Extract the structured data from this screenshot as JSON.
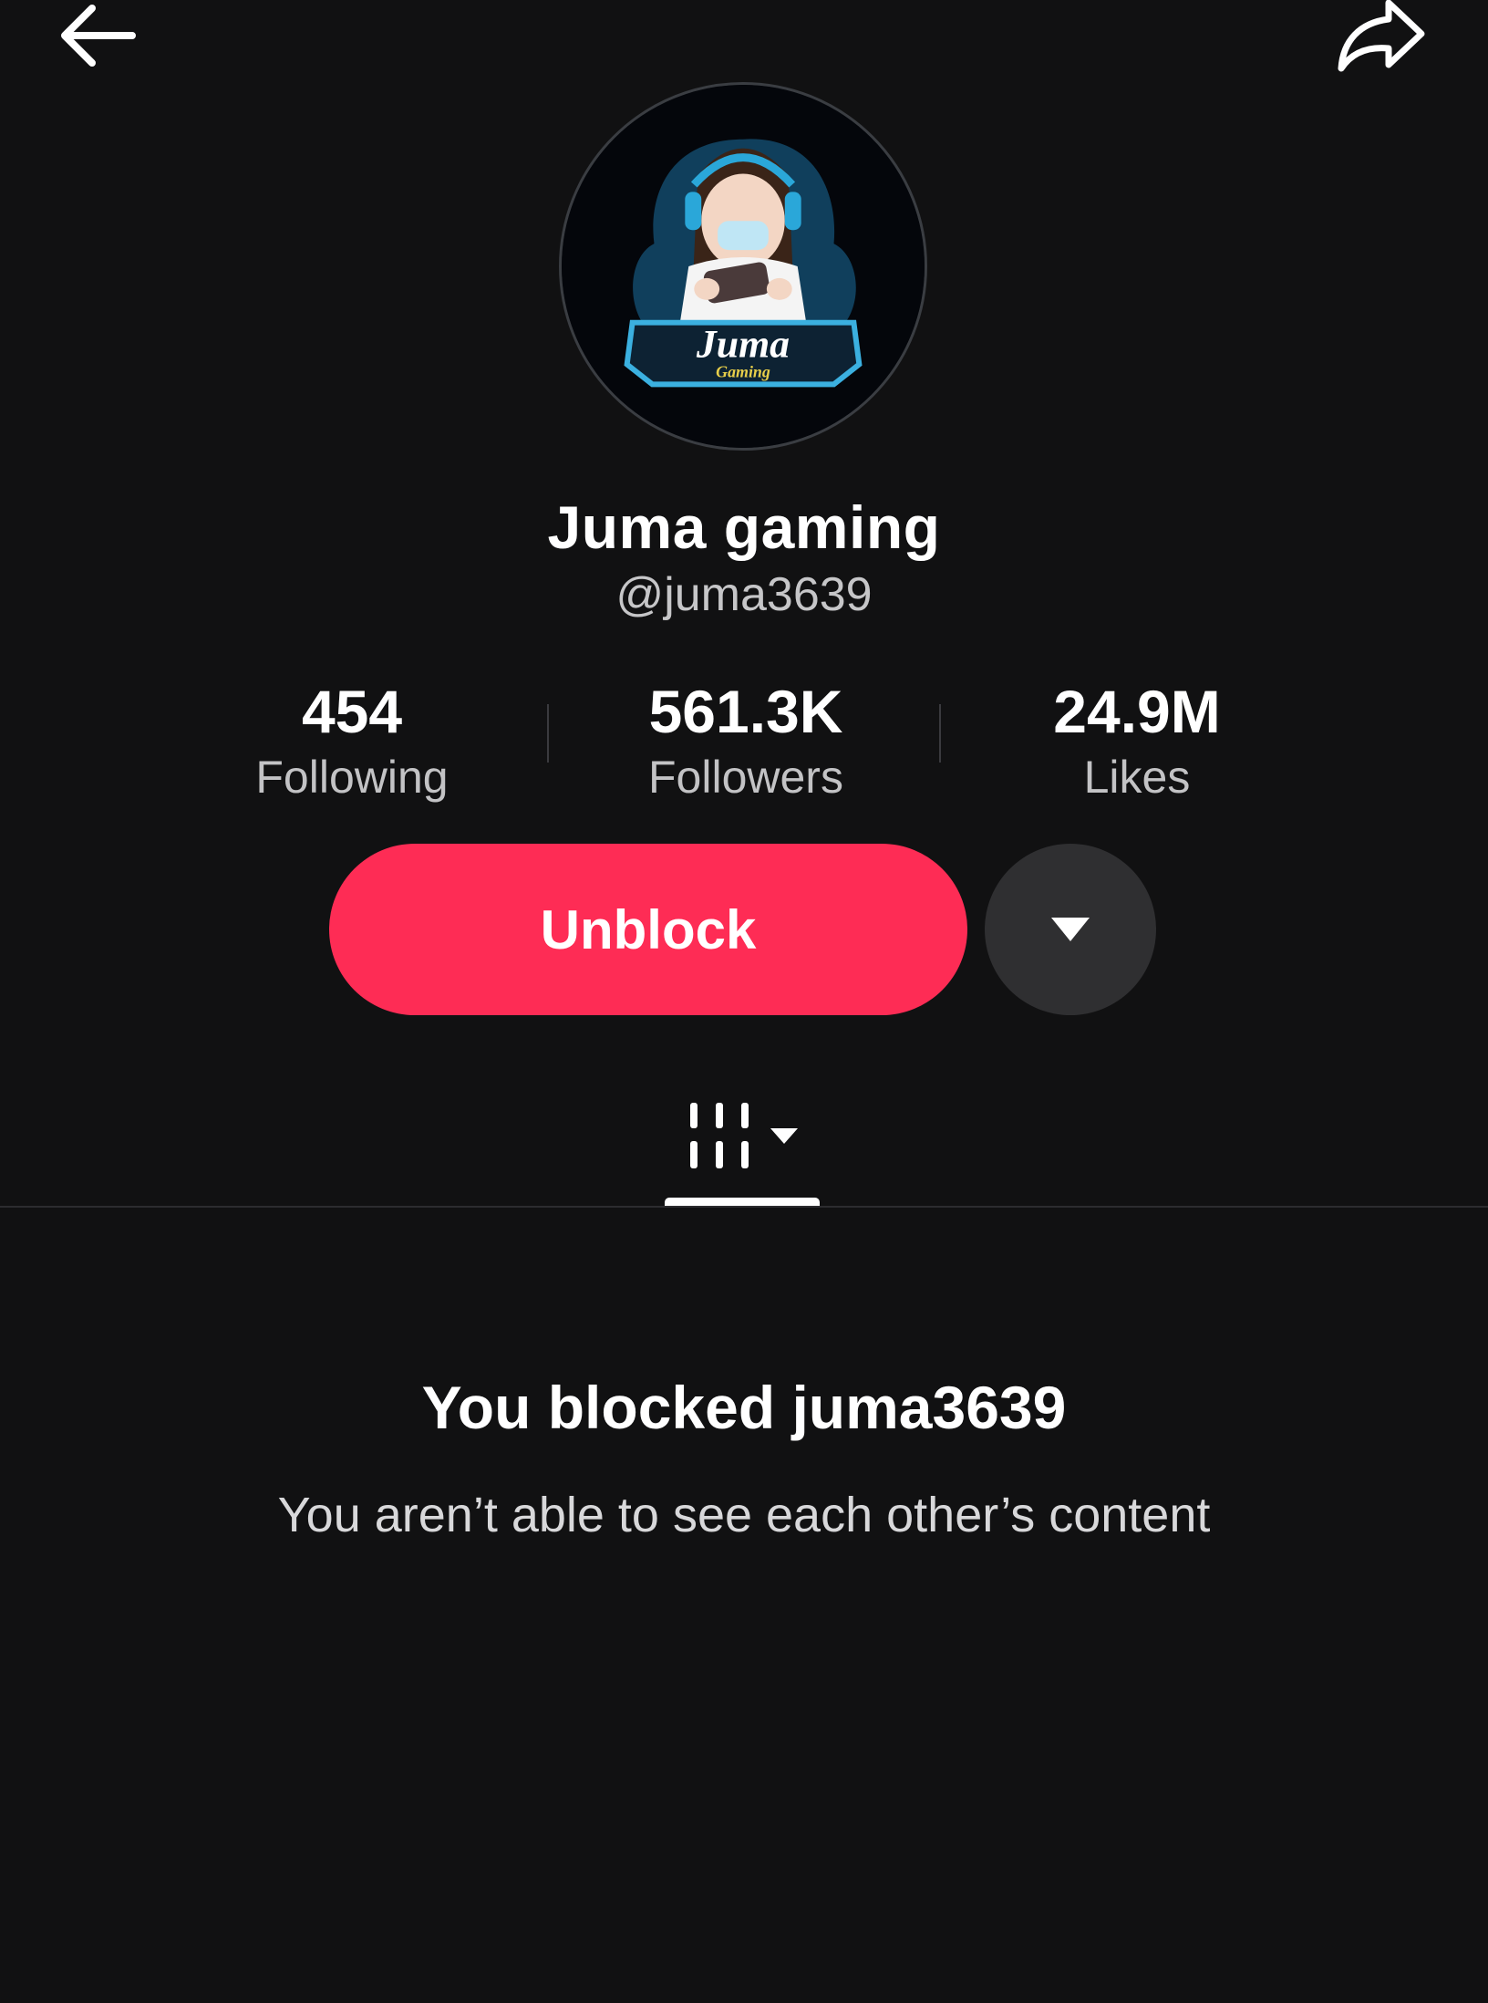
{
  "nav": {
    "back_icon": "arrow-left-icon",
    "share_icon": "share-arrow-icon"
  },
  "profile": {
    "avatar": {
      "logo_title": "Juma",
      "logo_subtitle": "Gaming"
    },
    "display_name": "Juma gaming",
    "username": "@juma3639"
  },
  "stats": {
    "following": {
      "value": "454",
      "label": "Following"
    },
    "followers": {
      "value": "561.3K",
      "label": "Followers"
    },
    "likes": {
      "value": "24.9M",
      "label": "Likes"
    }
  },
  "actions": {
    "unblock_label": "Unblock",
    "more_icon": "caret-down-icon"
  },
  "tabs": {
    "videos_icon": "grid-bars-icon",
    "dropdown_icon": "caret-down-icon"
  },
  "blocked": {
    "title": "You blocked juma3639",
    "subtitle": "You aren’t able to see each other’s content"
  },
  "colors": {
    "background": "#111112",
    "accent": "#fe2c55",
    "secondary_button": "#2f2f31"
  }
}
